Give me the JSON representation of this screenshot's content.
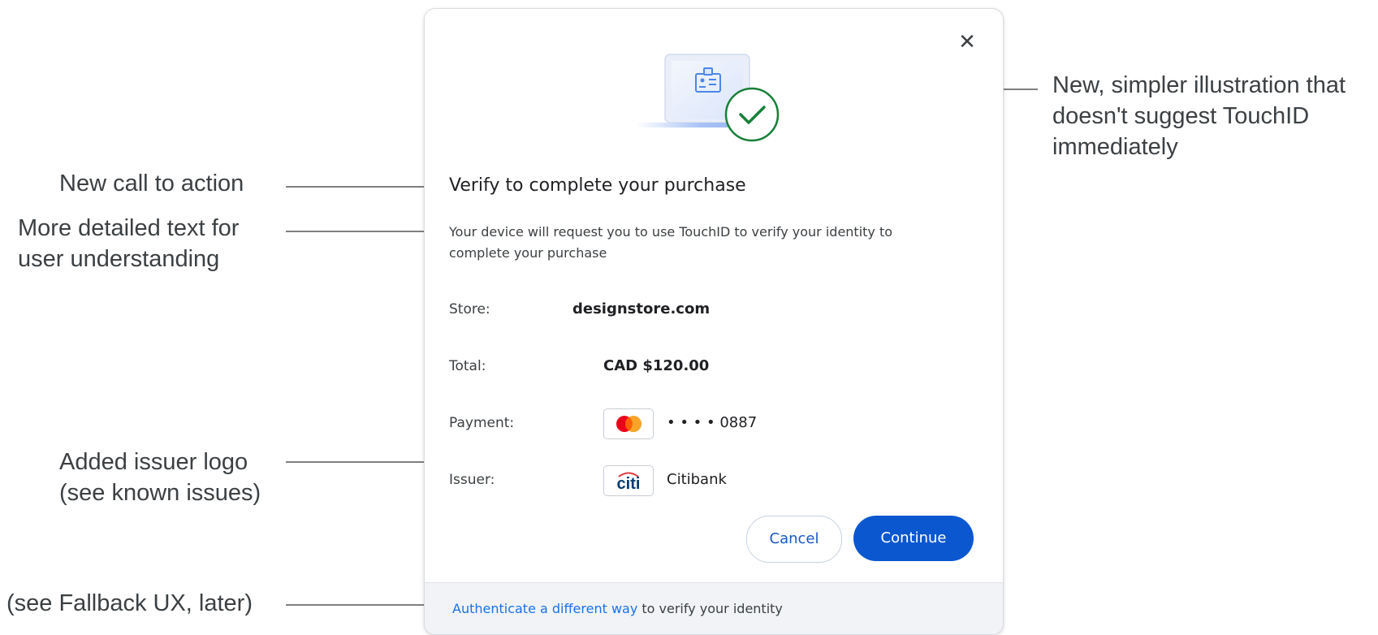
{
  "dialog": {
    "close_label": "✕",
    "title": "Verify to complete your purchase",
    "description": "Your device will request you to use TouchID to verify your identity to complete your purchase",
    "details": {
      "store_label": "Store:",
      "store_value": "designstore.com",
      "total_label": "Total:",
      "total_value": "CAD $120.00",
      "payment_label": "Payment:",
      "payment_value": "• • • • 0887",
      "issuer_label": "Issuer:",
      "issuer_logo_text": "citi",
      "issuer_value": "Citibank"
    },
    "buttons": {
      "cancel": "Cancel",
      "continue": "Continue"
    },
    "footer": {
      "link": "Authenticate a different way",
      "suffix": " to verify your identity"
    },
    "colors": {
      "primary": "#0b57d0",
      "link": "#1a73e8",
      "check_green": "#188038",
      "mastercard_red": "#eb001b",
      "mastercard_orange": "#f79e1b"
    }
  },
  "annotations": {
    "illustration": "New, simpler illustration that doesn't suggest TouchID immediately",
    "illustration_lines": [
      "New, simpler illustration that",
      "doesn't suggest TouchID",
      "immediately"
    ],
    "cta": "New call to action",
    "detailed_text_lines": [
      "More detailed text for",
      "user understanding"
    ],
    "issuer_logo_lines": [
      "Added issuer logo",
      "(see known issues)"
    ],
    "fallback": "(see Fallback UX, later)"
  },
  "icons": {
    "close": "close-icon",
    "illustration": "laptop-badge-check-illustration",
    "card": "mastercard-logo",
    "issuer": "citi-logo"
  }
}
